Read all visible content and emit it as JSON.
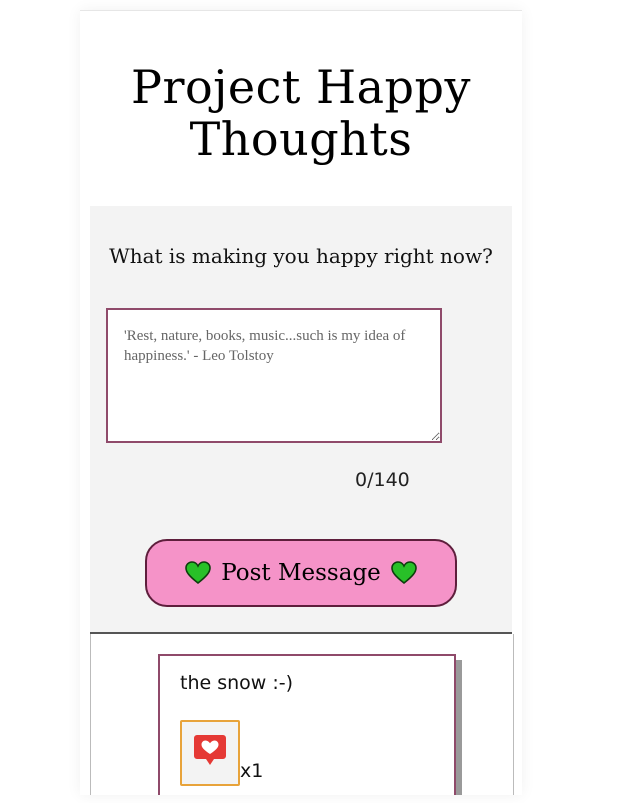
{
  "header": {
    "title": "Project Happy Thoughts"
  },
  "form": {
    "prompt": "What is making you happy right now?",
    "input_value": "",
    "input_placeholder": "'Rest, nature, books, music...such is my idea of happiness.' - Leo Tolstoy",
    "char_count": "0/140",
    "post_button_label": "Post Message",
    "post_button_icon": "green-heart-icon",
    "accent_color": "#f593c8",
    "border_color": "#8f4a6a"
  },
  "thoughts": [
    {
      "message": "the snow :-)",
      "like_icon": "heart-speech-bubble-icon",
      "likes_label": "x1",
      "like_border_color": "#e8a33a"
    }
  ]
}
